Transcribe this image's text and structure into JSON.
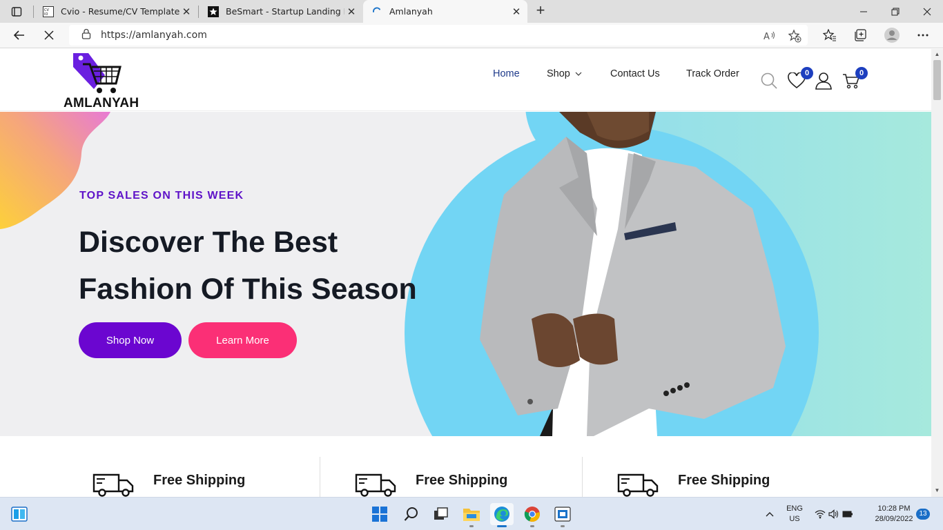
{
  "browser": {
    "tabs": [
      {
        "title": "Cvio - Resume/CV Template",
        "active": false
      },
      {
        "title": "BeSmart - Startup Landing Page",
        "active": false
      },
      {
        "title": "Amlanyah",
        "active": true
      }
    ],
    "url": "https://amlanyah.com"
  },
  "site": {
    "logo_text": "AMLANYAH",
    "nav": {
      "home": "Home",
      "shop": "Shop",
      "contact": "Contact Us",
      "track": "Track Order"
    },
    "wishlist_count": "0",
    "cart_count": "0"
  },
  "hero": {
    "eyebrow": "TOP SALES ON THIS WEEK",
    "title_line1": "Discover The Best",
    "title_line2": "Fashion Of This Season",
    "primary_button": "Shop Now",
    "secondary_button": "Learn More"
  },
  "features": [
    {
      "title": "Free Shipping"
    },
    {
      "title": "Free Shipping"
    },
    {
      "title": "Free Shipping"
    }
  ],
  "taskbar": {
    "language": "ENG",
    "region": "US",
    "time": "10:28 PM",
    "date": "28/09/2022",
    "notifications": "13"
  },
  "colors": {
    "accent_purple": "#6b06d0",
    "accent_pink": "#fb2f76",
    "nav_active": "#1e3a8a",
    "badge": "#1d3fbf"
  }
}
